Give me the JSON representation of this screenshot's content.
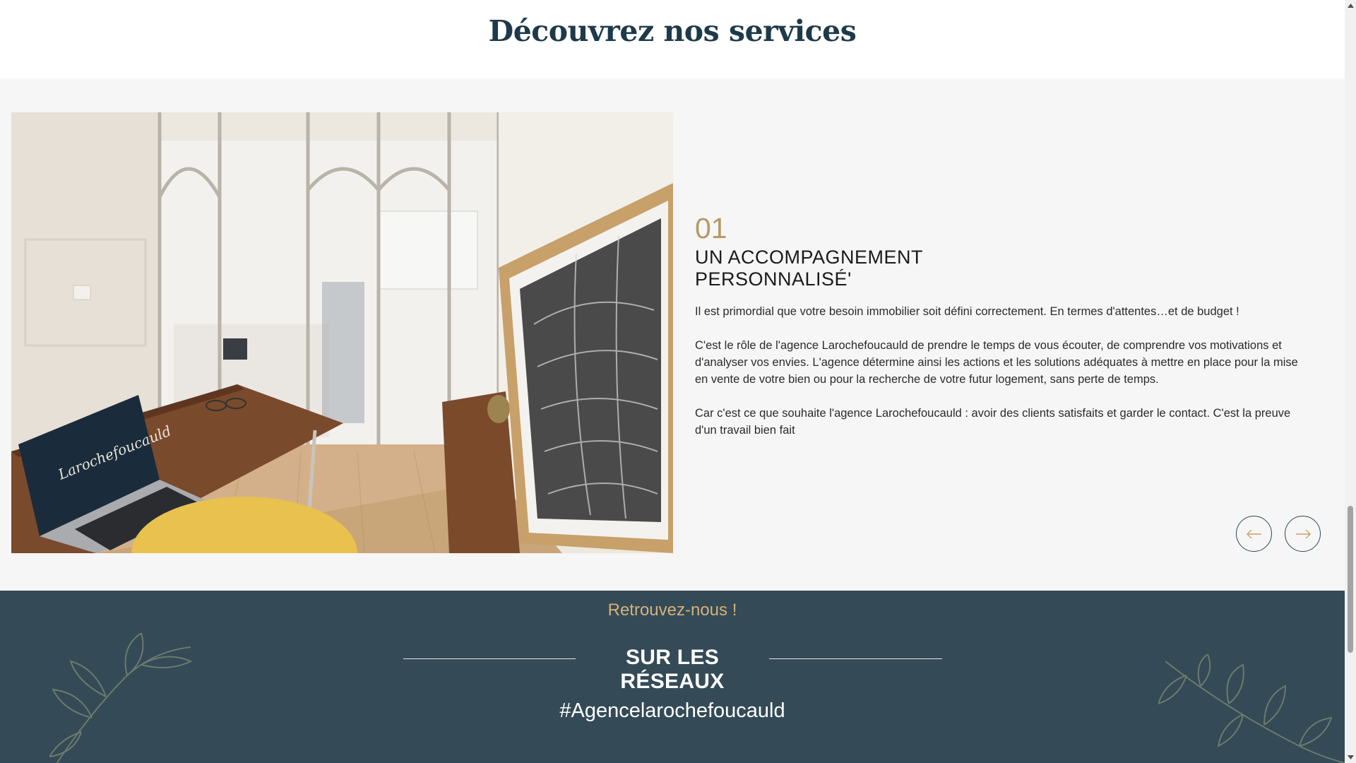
{
  "services": {
    "title": "Découvrez nos services",
    "current": {
      "number": "01",
      "title": "UN ACCOMPAGNEMENT PERSONNALISÉ'",
      "paragraphs": [
        "Il est primordial que votre besoin immobilier soit défini correctement. En termes d'attentes…et de budget !",
        "C'est le rôle de l'agence Larochefoucauld de prendre le temps de vous écouter, de comprendre vos motivations et d'analyser vos envies. L'agence détermine ainsi les actions et les solutions adéquates à mettre en place pour la mise en vente de votre bien ou pour la recherche de votre futur logement, sans perte de temps.",
        "Car c'est ce que souhaite l'agence Larochefoucauld : avoir des clients satisfaits et garder le contact. C'est la preuve d'un travail bien fait"
      ],
      "photo_logo_text": "Larochefoucauld"
    },
    "nav": {
      "prev_icon": "arrow-left-icon",
      "next_icon": "arrow-right-icon"
    }
  },
  "social": {
    "kicker": "Retrouvez-nous !",
    "heading": "SUR LES RÉSEAUX",
    "hashtag": "#Agencelarochefoucauld"
  },
  "colors": {
    "title": "#1e3a4a",
    "accent_gold": "#b49a66",
    "social_bg": "#344a57",
    "section_bg": "#f6f6f6"
  }
}
